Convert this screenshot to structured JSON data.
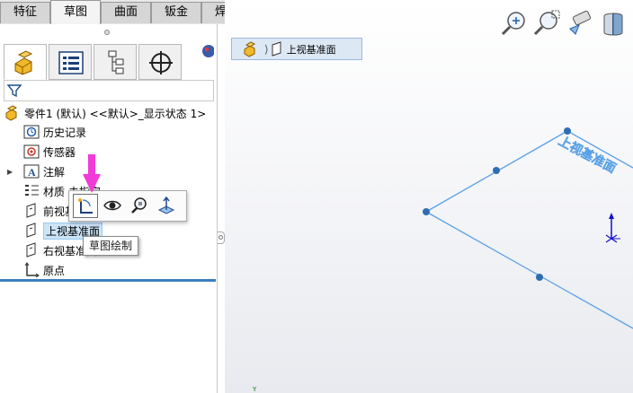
{
  "command_tabs": [
    "特征",
    "草图",
    "曲面",
    "钣金",
    "焊件"
  ],
  "active_command_tab": "草图",
  "panel_tabs": [
    {
      "icon": "featuremanager-icon"
    },
    {
      "icon": "propertymanager-icon"
    },
    {
      "icon": "configurationmanager-icon"
    },
    {
      "icon": "dimxpert-icon"
    }
  ],
  "panel_scroll": {
    "left": "◀",
    "right": "▶"
  },
  "tree": {
    "root": "零件1 (默认) <<默认>_显示状态 1>",
    "items": [
      {
        "label": "历史记录",
        "icon": "history-icon"
      },
      {
        "label": "传感器",
        "icon": "sensor-icon"
      },
      {
        "label": "注解",
        "icon": "annotation-icon"
      },
      {
        "label": "材质",
        "icon": "material-icon"
      },
      {
        "label": "前视基准面",
        "icon": "plane-icon"
      },
      {
        "label": "上视基准面",
        "icon": "plane-icon"
      },
      {
        "label": "右视基准面",
        "icon": "plane-icon"
      },
      {
        "label": "原点",
        "icon": "origin-icon"
      }
    ],
    "material_suffix": "未指定",
    "selected_index": 5
  },
  "context_toolbar": {
    "tooltip": "草图绘制",
    "buttons": [
      "sketch-icon",
      "eye-icon",
      "zoom-to-selection-icon",
      "normal-to-icon"
    ]
  },
  "viewport": {
    "breadcrumb": "上视基准面",
    "plane_label": "上视基准面",
    "tools": [
      "zoom-to-fit-icon",
      "zoom-to-area-icon",
      "previous-view-icon",
      "section-view-icon"
    ],
    "triad_y": "Y",
    "colors": {
      "plane": "#5aa0e6",
      "handle": "#2f6db3",
      "triad_blue": "#1010d0"
    }
  }
}
